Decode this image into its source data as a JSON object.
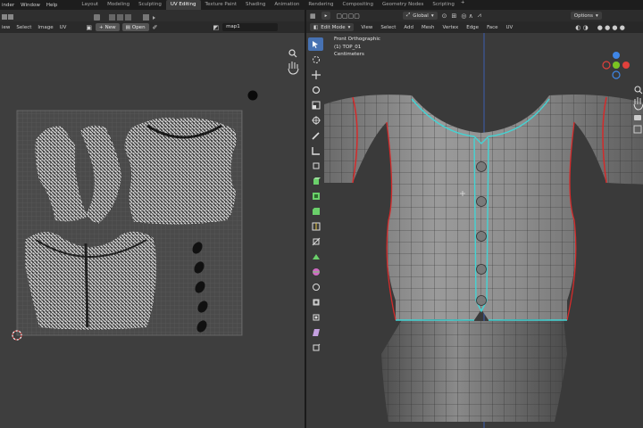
{
  "topbar": {
    "menu": [
      "inder",
      "Window",
      "Help"
    ],
    "tabs": [
      "Layout",
      "Modeling",
      "Sculpting",
      "UV Editing",
      "Texture Paint",
      "Shading",
      "Animation",
      "Rendering",
      "Compositing",
      "Geometry Nodes",
      "Scripting"
    ],
    "active_tab": "UV Editing",
    "add_tab_symbol": "+"
  },
  "uv_editor": {
    "menu": [
      "iew",
      "Select",
      "Image",
      "UV"
    ],
    "new_button": "New",
    "open_button": "Open",
    "uv_map_name": "map1"
  },
  "viewport": {
    "mode": "Edit Mode",
    "orientation": "Global",
    "menu": [
      "View",
      "Select",
      "Add",
      "Mesh",
      "Vertex",
      "Edge",
      "Face",
      "UV"
    ],
    "options_label": "Options",
    "info": {
      "view_name": "Front Orthographic",
      "object_name": "(1) TOP_01",
      "units": "Centimeters"
    }
  },
  "colors": {
    "seam": "#d42b2b",
    "selected_edge": "#43d4d4",
    "accent": "#4772b3",
    "axis_x": "#e0403c",
    "axis_y": "#7ac41f",
    "axis_z": "#3f86e6"
  }
}
